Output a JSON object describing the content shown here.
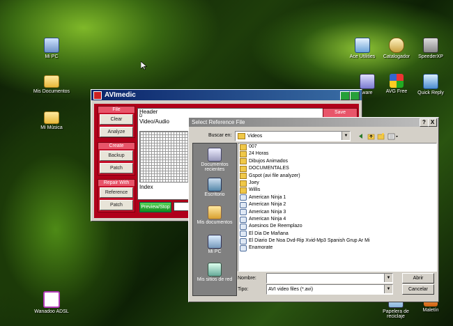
{
  "desktop": {
    "icons": [
      {
        "label": "Mi PC",
        "icon": "computer-icon"
      },
      {
        "label": "Mis Documentos",
        "icon": "folder-icon"
      },
      {
        "label": "Mi Música",
        "icon": "folder-icon"
      },
      {
        "label": "Wanadoo ADSL",
        "icon": "wanadoo-icon"
      },
      {
        "label": "Ace Utilities",
        "icon": "ace-utilities-icon"
      },
      {
        "label": "Catalogador",
        "icon": "catalog-icon"
      },
      {
        "label": "SpeederXP",
        "icon": "speeder-icon"
      },
      {
        "label": "ware",
        "icon": "software-icon"
      },
      {
        "label": "AVG Free",
        "icon": "avg-icon"
      },
      {
        "label": "Quick Reply",
        "icon": "quick-reply-icon"
      },
      {
        "label": "Papelera de reciclaje",
        "icon": "recycle-bin-icon"
      },
      {
        "label": "Maletín",
        "icon": "briefcase-icon"
      }
    ]
  },
  "avimedic": {
    "title": "AVImedic",
    "sections": {
      "file": {
        "label": "File",
        "buttons": [
          "Clear",
          "Analyze"
        ]
      },
      "create": {
        "label": "Create",
        "buttons": [
          "Backup",
          "Patch"
        ]
      },
      "repair": {
        "label": "Repair With",
        "buttons": [
          "Reference",
          "Patch"
        ]
      }
    },
    "panel": {
      "header": "Header",
      "header_sub": "D",
      "video_audio": "Video/Audio",
      "index": "Index"
    },
    "right_label": "Save",
    "green_button": "Preview/Stop"
  },
  "dialog": {
    "title": "Select Reference File",
    "help": "?",
    "close": "X",
    "look_in_label": "Buscar en:",
    "look_in_value": "Videos",
    "places": [
      "Documentos recientes",
      "Escritorio",
      "Mis documentos",
      "Mi PC",
      "Mis sitios de red"
    ],
    "files": [
      {
        "name": "007",
        "type": "folder"
      },
      {
        "name": "24 Horas",
        "type": "folder"
      },
      {
        "name": "Dibujos Animados",
        "type": "folder"
      },
      {
        "name": "DOCUMENTALES",
        "type": "folder"
      },
      {
        "name": "Gspot (avi file analyzer)",
        "type": "folder"
      },
      {
        "name": "Joey",
        "type": "folder"
      },
      {
        "name": "Willis",
        "type": "folder"
      },
      {
        "name": "American Ninja 1",
        "type": "video"
      },
      {
        "name": "American Ninja 2",
        "type": "video"
      },
      {
        "name": "American Ninja 3",
        "type": "video"
      },
      {
        "name": "American Ninja 4",
        "type": "video"
      },
      {
        "name": "Asesinos De Reemplazo",
        "type": "video"
      },
      {
        "name": "El Dia De Mañana",
        "type": "video"
      },
      {
        "name": "El Diario De Noa Dvd-Rip Xvid-Mp3 Spanish Grup Ar Mi",
        "type": "video"
      },
      {
        "name": "Enamorate",
        "type": "video"
      }
    ],
    "name_label": "Nombre:",
    "name_value": "",
    "type_label": "Tipo:",
    "type_value": "AVI video files (*.avi)",
    "open_button": "Abrir",
    "cancel_button": "Cancelar"
  }
}
